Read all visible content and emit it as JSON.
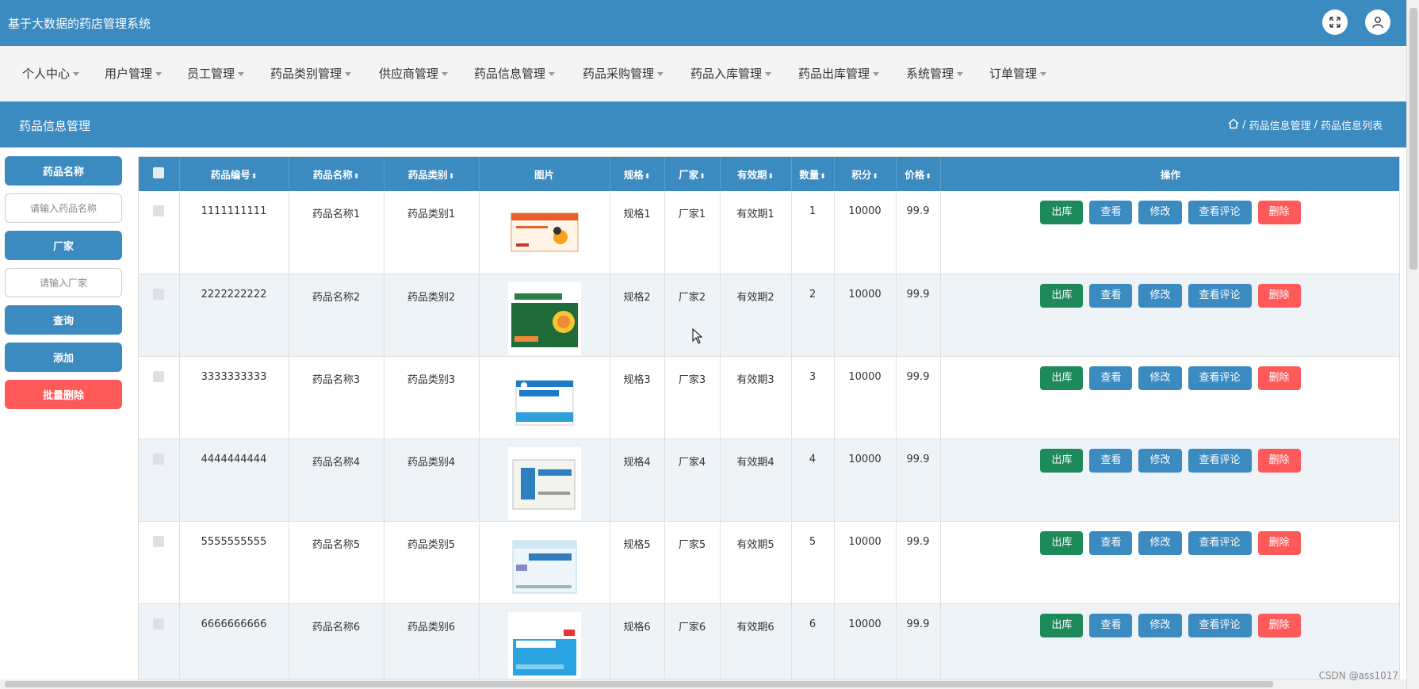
{
  "app_title": "基于大数据的药店管理系统",
  "nav": [
    "个人中心",
    "用户管理",
    "员工管理",
    "药品类别管理",
    "供应商管理",
    "药品信息管理",
    "药品采购管理",
    "药品入库管理",
    "药品出库管理",
    "系统管理",
    "订单管理"
  ],
  "section_title": "药品信息管理",
  "breadcrumb": {
    "part1": "药品信息管理",
    "sep": "/",
    "part2": "药品信息列表"
  },
  "sidebar": {
    "name_label": "药品名称",
    "name_placeholder": "请输入药品名称",
    "vendor_label": "厂家",
    "vendor_placeholder": "请输入厂家",
    "search": "查询",
    "add": "添加",
    "batch_delete": "批量删除"
  },
  "table": {
    "headers": {
      "code": "药品编号",
      "name": "药品名称",
      "category": "药品类别",
      "image": "图片",
      "spec": "规格",
      "vendor": "厂家",
      "expiry": "有效期",
      "qty": "数量",
      "points": "积分",
      "price": "价格",
      "ops": "操作"
    },
    "ops": {
      "out": "出库",
      "view": "查看",
      "edit": "修改",
      "reviews": "查看评论",
      "delete": "删除"
    },
    "rows": [
      {
        "code": "1111111111",
        "name": "药品名称1",
        "category": "药品类别1",
        "spec": "规格1",
        "vendor": "厂家1",
        "expiry": "有效期1",
        "qty": "1",
        "points": "10000",
        "price": "99.9"
      },
      {
        "code": "2222222222",
        "name": "药品名称2",
        "category": "药品类别2",
        "spec": "规格2",
        "vendor": "厂家2",
        "expiry": "有效期2",
        "qty": "2",
        "points": "10000",
        "price": "99.9"
      },
      {
        "code": "3333333333",
        "name": "药品名称3",
        "category": "药品类别3",
        "spec": "规格3",
        "vendor": "厂家3",
        "expiry": "有效期3",
        "qty": "3",
        "points": "10000",
        "price": "99.9"
      },
      {
        "code": "4444444444",
        "name": "药品名称4",
        "category": "药品类别4",
        "spec": "规格4",
        "vendor": "厂家4",
        "expiry": "有效期4",
        "qty": "4",
        "points": "10000",
        "price": "99.9"
      },
      {
        "code": "5555555555",
        "name": "药品名称5",
        "category": "药品类别5",
        "spec": "规格5",
        "vendor": "厂家5",
        "expiry": "有效期5",
        "qty": "5",
        "points": "10000",
        "price": "99.9"
      },
      {
        "code": "6666666666",
        "name": "药品名称6",
        "category": "药品类别6",
        "spec": "规格6",
        "vendor": "厂家6",
        "expiry": "有效期6",
        "qty": "6",
        "points": "10000",
        "price": "99.9"
      }
    ]
  },
  "watermark": "CSDN @ass1017",
  "colors": {
    "primary": "#3b8ac0",
    "out": "#1e8a5a",
    "danger": "#ff5a5a"
  }
}
